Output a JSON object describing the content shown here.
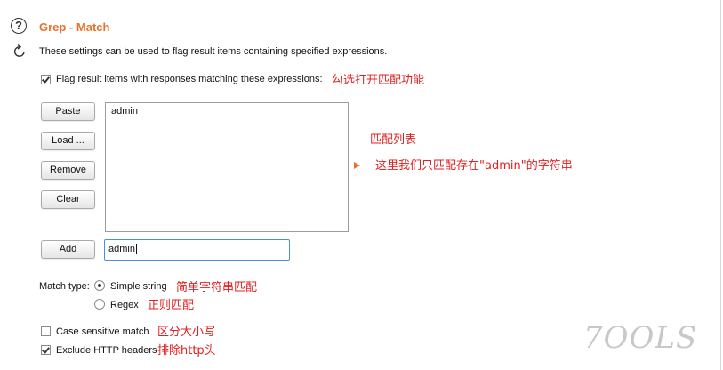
{
  "section": {
    "title": "Grep - Match",
    "description": "These settings can be used to flag result items containing specified expressions."
  },
  "flag": {
    "label": "Flag result items with responses matching these expressions:",
    "checked": true,
    "annotation": "勾选打开匹配功能"
  },
  "buttons": {
    "paste": "Paste",
    "load": "Load ...",
    "remove": "Remove",
    "clear": "Clear",
    "add": "Add"
  },
  "list": {
    "items": [
      "admin"
    ],
    "annotation": "匹配列表",
    "arrow_note": "这里我们只匹配存在\"admin\"的字符串"
  },
  "input": {
    "value": "admin"
  },
  "match_type": {
    "label": "Match type:",
    "options": [
      {
        "label": "Simple string",
        "selected": true,
        "annotation": "简单字符串匹配"
      },
      {
        "label": "Regex",
        "selected": false,
        "annotation": "正则匹配"
      }
    ]
  },
  "case_sensitive": {
    "label": "Case sensitive match",
    "checked": false,
    "annotation": "区分大小写"
  },
  "exclude_headers": {
    "label": "Exclude HTTP headers",
    "checked": true,
    "annotation": "排除http头"
  },
  "watermark": "7OOLS",
  "colors": {
    "accent": "#e8722e",
    "annotation": "#e02020",
    "focus": "#4a90d9"
  }
}
